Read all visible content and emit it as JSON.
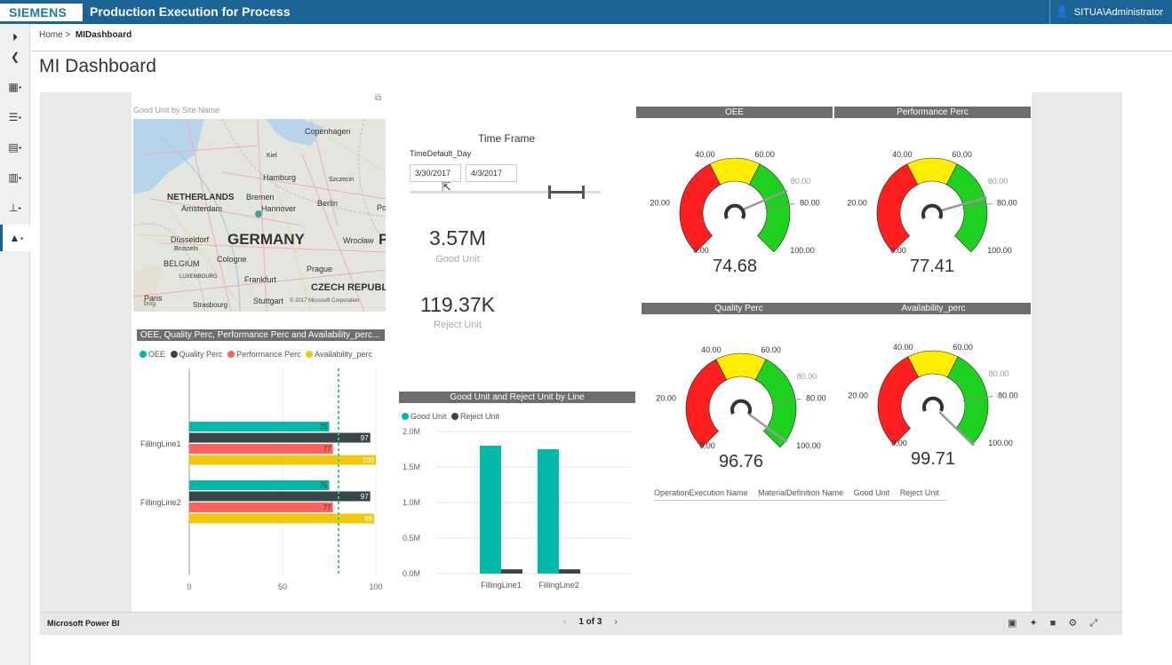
{
  "header": {
    "brand": "SIEMENS",
    "app_title": "Production Execution for Process",
    "user": "SITUA\\Administrator"
  },
  "sidebar": {
    "items": [
      {
        "icon": "expand-arrow-icon",
        "glyph": "⏵"
      },
      {
        "icon": "back-icon",
        "glyph": "❮"
      },
      {
        "icon": "calendar-icon",
        "glyph": "▦"
      },
      {
        "icon": "list-icon",
        "glyph": "☰"
      },
      {
        "icon": "clipboard-icon",
        "glyph": "▤"
      },
      {
        "icon": "document-icon",
        "glyph": "▥"
      },
      {
        "icon": "hierarchy-icon",
        "glyph": "⊥"
      },
      {
        "icon": "chart-icon",
        "glyph": "▲"
      }
    ]
  },
  "breadcrumb": {
    "home": "Home",
    "sep": ">",
    "current": "MIDashboard"
  },
  "page": {
    "title": "MI Dashboard"
  },
  "map": {
    "title": "Good Unit by Site Name",
    "labels": [
      "Copenhagen",
      "Kiel",
      "Hamburg",
      "Szczecin",
      "NETHERLANDS",
      "Bremen",
      "Amsterdam",
      "Hannover",
      "Berlin",
      "Po",
      "Düsseldorf",
      "GERMANY",
      "Wrocław",
      "P",
      "Brussels",
      "Cologne",
      "BELGIUM",
      "LUXEMBOURG",
      "Frankfurt",
      "Prague",
      "Paris",
      "Strasbourg",
      "Stuttgart",
      "CZECH REPUBL",
      "bing",
      "© 2017 Microsoft Corporation"
    ]
  },
  "slicer": {
    "title": "Time Frame",
    "field": "TimeDefault_Day",
    "start": "3/30/2017",
    "end": "4/3/2017"
  },
  "kpis": [
    {
      "value": "3.57M",
      "label": "Good Unit"
    },
    {
      "value": "119.37K",
      "label": "Reject Unit"
    }
  ],
  "gauges": [
    {
      "title": "OEE",
      "value": 74.68,
      "display": "74.68",
      "target": 80
    },
    {
      "title": "Performance Perc",
      "value": 77.41,
      "display": "77.41",
      "target": 80
    },
    {
      "title": "Quality Perc",
      "value": 96.76,
      "display": "96.76",
      "target": 80
    },
    {
      "title": "Availability_perc",
      "value": 99.71,
      "display": "99.71",
      "target": 80
    }
  ],
  "gauge_ticks": [
    "0.00",
    "20.00",
    "40.00",
    "60.00",
    "80.00",
    "100.00"
  ],
  "table": {
    "headers": [
      "OperationExecution Name",
      "MaterialDefinition Name",
      "Good Unit",
      "Reject Unit"
    ]
  },
  "footer": {
    "brand": "Microsoft Power BI",
    "page": "1 of 3",
    "share_icons": [
      "linkedin-icon",
      "twitter-icon",
      "facebook-icon",
      "settings-icon",
      "fullscreen-icon"
    ]
  },
  "colors": {
    "header_blue": "#1d6496",
    "teal": "#01b8aa",
    "dark": "#374649",
    "salmon": "#fd625e",
    "yellow": "#f2c80f",
    "gauge_red": "#ff1f1f",
    "gauge_yellow": "#ffee00",
    "gauge_green": "#1fd11f"
  },
  "chart_data": [
    {
      "type": "bar",
      "orientation": "horizontal",
      "title": "OEE, Quality Perc, Performance Perc and Availability_perc...",
      "categories": [
        "FillingLine1",
        "FillingLine2"
      ],
      "series": [
        {
          "name": "OEE",
          "values": [
            75,
            75
          ]
        },
        {
          "name": "Quality Perc",
          "values": [
            97,
            97
          ]
        },
        {
          "name": "Performance Perc",
          "values": [
            77,
            77
          ]
        },
        {
          "name": "Availability_perc",
          "values": [
            100,
            99
          ]
        }
      ],
      "x_ticks": [
        "0",
        "50",
        "100"
      ],
      "xlim": [
        0,
        100
      ],
      "reference_line": 80,
      "legend_position": "top-left"
    },
    {
      "type": "bar",
      "title": "Good Unit and Reject Unit by Line",
      "categories": [
        "FillingLine1",
        "FillingLine2"
      ],
      "series": [
        {
          "name": "Good Unit",
          "values": [
            1800000,
            1750000
          ]
        },
        {
          "name": "Reject Unit",
          "values": [
            60000,
            60000
          ]
        }
      ],
      "y_ticks": [
        "0.0M",
        "0.5M",
        "1.0M",
        "1.5M",
        "2.0M"
      ],
      "ylim": [
        0,
        2000000
      ],
      "grid": true,
      "legend_position": "top-left"
    }
  ]
}
